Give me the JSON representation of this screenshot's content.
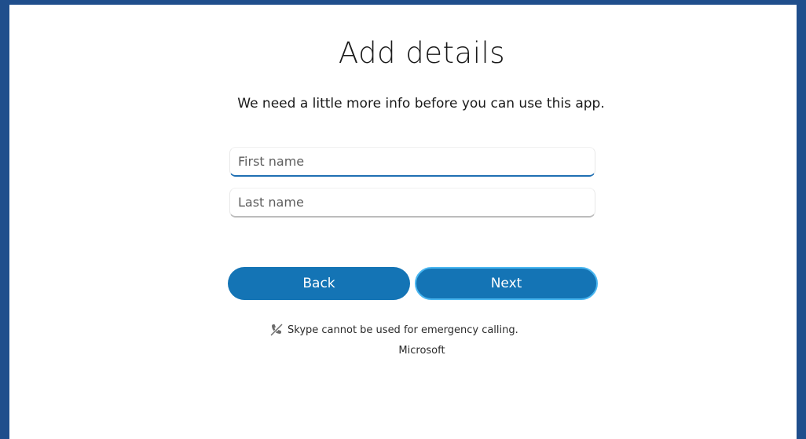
{
  "page": {
    "title": "Add details",
    "subtitle": "We need a little more info before you can use this app."
  },
  "form": {
    "first_name": {
      "placeholder": "First name",
      "value": ""
    },
    "last_name": {
      "placeholder": "Last name",
      "value": ""
    }
  },
  "buttons": {
    "back_label": "Back",
    "next_label": "Next"
  },
  "footer": {
    "emergency_notice": "Skype cannot be used for emergency calling.",
    "emergency_icon": "no-phone-icon",
    "brand": "Microsoft"
  },
  "colors": {
    "frame": "#1f4e8c",
    "accent": "#1474b5",
    "focus_ring": "#49b6f0"
  }
}
